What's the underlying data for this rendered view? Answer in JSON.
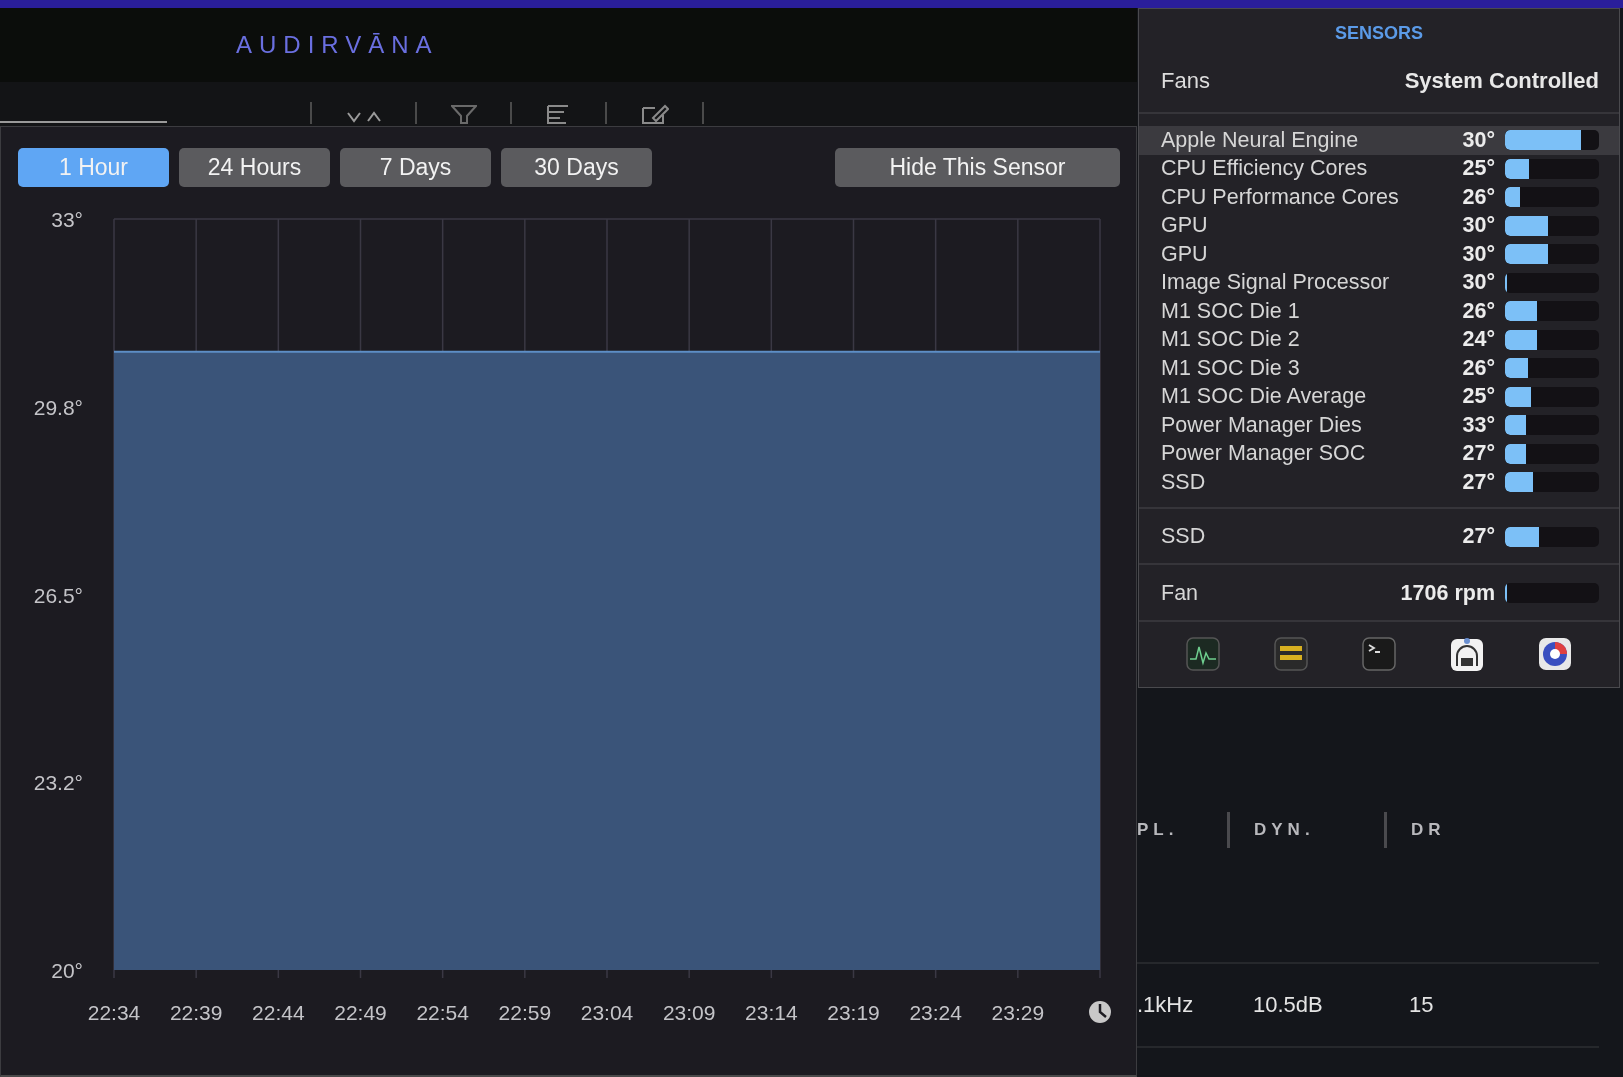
{
  "app": {
    "logo": "AUDIRVĀNA"
  },
  "history_popover": {
    "ranges": [
      {
        "label": "1 Hour",
        "selected": true
      },
      {
        "label": "24 Hours",
        "selected": false
      },
      {
        "label": "7 Days",
        "selected": false
      },
      {
        "label": "30 Days",
        "selected": false
      }
    ],
    "hide_button": "Hide This Sensor",
    "chart_data": {
      "type": "area",
      "categories": [
        "22:34",
        "22:39",
        "22:44",
        "22:49",
        "22:54",
        "22:59",
        "23:04",
        "23:09",
        "23:14",
        "23:19",
        "23:24",
        "23:29",
        null
      ],
      "ylim": [
        20,
        33
      ],
      "grid": true,
      "series": [
        {
          "color": "#3a5479",
          "values": [
            30.7,
            30.7,
            30.7,
            30.7,
            30.7,
            30.7,
            30.7,
            30.7,
            30.7,
            30.7,
            30.7,
            30.7,
            30.7
          ]
        }
      ],
      "yticks": [
        {
          "value": 33,
          "label": "33°"
        },
        {
          "value": 29.75,
          "label": "29.8°"
        },
        {
          "value": 26.5,
          "label": "26.5°"
        },
        {
          "value": 23.25,
          "label": "23.2°"
        },
        {
          "value": 20,
          "label": "20°"
        }
      ]
    }
  },
  "sensors_panel": {
    "title": "SENSORS",
    "fans_label": "Fans",
    "fans_mode": "System Controlled",
    "groups": [
      {
        "rows": [
          {
            "name": "Apple Neural Engine",
            "reading": "30°",
            "level": 0.81,
            "selected": true
          },
          {
            "name": "CPU Efficiency Cores",
            "reading": "25°",
            "level": 0.26,
            "selected": false
          },
          {
            "name": "CPU Performance Cores",
            "reading": "26°",
            "level": 0.16,
            "selected": false
          },
          {
            "name": "GPU",
            "reading": "30°",
            "level": 0.46,
            "selected": false
          },
          {
            "name": "GPU",
            "reading": "30°",
            "level": 0.46,
            "selected": false
          },
          {
            "name": "Image Signal Processor",
            "reading": "30°",
            "level": 0,
            "selected": false
          },
          {
            "name": "M1 SOC Die 1",
            "reading": "26°",
            "level": 0.34,
            "selected": false
          },
          {
            "name": "M1 SOC Die 2",
            "reading": "24°",
            "level": 0.34,
            "selected": false
          },
          {
            "name": "M1 SOC Die 3",
            "reading": "26°",
            "level": 0.24,
            "selected": false
          },
          {
            "name": "M1 SOC Die Average",
            "reading": "25°",
            "level": 0.28,
            "selected": false
          },
          {
            "name": "Power Manager Dies",
            "reading": "33°",
            "level": 0.22,
            "selected": false
          },
          {
            "name": "Power Manager SOC",
            "reading": "27°",
            "level": 0.22,
            "selected": false
          },
          {
            "name": "SSD",
            "reading": "27°",
            "level": 0.3,
            "selected": false
          }
        ]
      },
      {
        "rows": [
          {
            "name": "SSD",
            "reading": "27°",
            "level": 0.36,
            "selected": false
          }
        ]
      },
      {
        "rows": [
          {
            "name": "Fan",
            "reading": "1706 rpm",
            "level": 0.02,
            "selected": false
          }
        ]
      }
    ]
  },
  "track_table": {
    "columns": [
      "PL.",
      "DYN.",
      "DR"
    ],
    "rows": [
      [
        ".1kHz",
        "10.5dB",
        "15"
      ]
    ]
  }
}
